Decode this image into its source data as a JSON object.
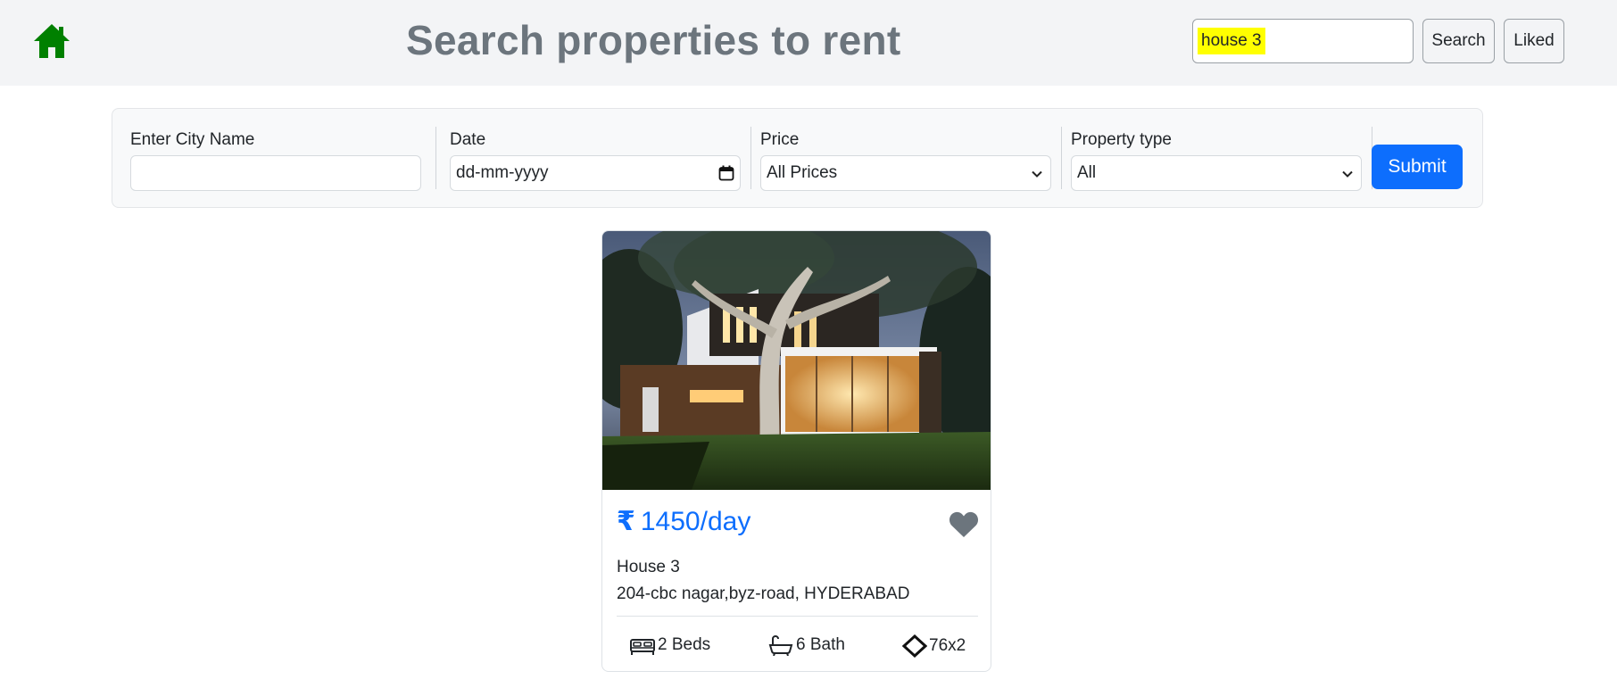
{
  "header": {
    "title": "Search properties to rent",
    "search_value": "house 3",
    "search_button": "Search",
    "liked_button": "Liked",
    "home_icon": "home-icon",
    "brand_color": "#008000"
  },
  "filters": {
    "city_label": "Enter City Name",
    "city_value": "",
    "date_label": "Date",
    "date_placeholder": "dd-mm-yyyy",
    "price_label": "Price",
    "price_selected": "All Prices",
    "type_label": "Property type",
    "type_selected": "All",
    "submit_label": "Submit",
    "accent_color": "#0d6efd"
  },
  "listing": {
    "currency_symbol": "₹",
    "price": "1450/day",
    "name": "House 3",
    "address": "204-cbc nagar,byz-road, HYDERABAD",
    "beds": "2 Beds",
    "bath": "6 Bath",
    "area": "76x2",
    "liked_icon": "heart-icon",
    "image_alt": "modern house at dusk"
  }
}
